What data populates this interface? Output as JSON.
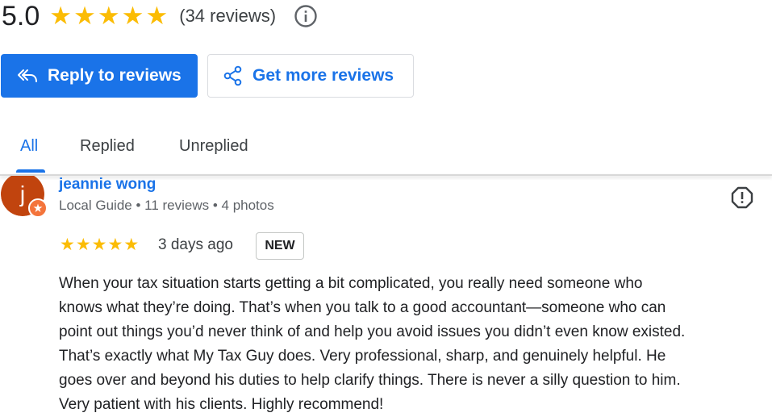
{
  "summary": {
    "rating": "5.0",
    "stars": [
      "★",
      "★",
      "★",
      "★",
      "★"
    ],
    "review_count": "(34 reviews)",
    "info_icon": "info-icon"
  },
  "actions": {
    "reply_label": "Reply to reviews",
    "reply_icon": "reply-all-icon",
    "get_more_label": "Get more reviews",
    "get_more_icon": "share-icon"
  },
  "tabs": [
    {
      "label": "All",
      "active": true
    },
    {
      "label": "Replied",
      "active": false
    },
    {
      "label": "Unreplied",
      "active": false
    }
  ],
  "review": {
    "author": "jeannie wong",
    "avatar_letter": "j",
    "meta": "Local Guide • 11 reviews • 4 photos",
    "stars": [
      "★",
      "★",
      "★",
      "★",
      "★"
    ],
    "date": "3 days ago",
    "badge": "NEW",
    "text_lines": [
      "When your tax situation starts getting a bit complicated, you really need someone who",
      "knows what they’re doing. That’s when you talk to a good accountant—someone who can",
      "point out things you’d never think of and help you avoid issues you didn’t even know existed.",
      "That’s exactly what My Tax Guy does. Very professional, sharp, and genuinely helpful. He",
      "goes over and beyond his duties to help clarify things. There is never a silly question to him.",
      "Very patient with his clients. Highly recommend!"
    ]
  },
  "colors": {
    "accent": "#1a73e8",
    "star": "#fbbc04",
    "avatar_bg": "#c1440e",
    "guide_badge": "#f4743b"
  }
}
